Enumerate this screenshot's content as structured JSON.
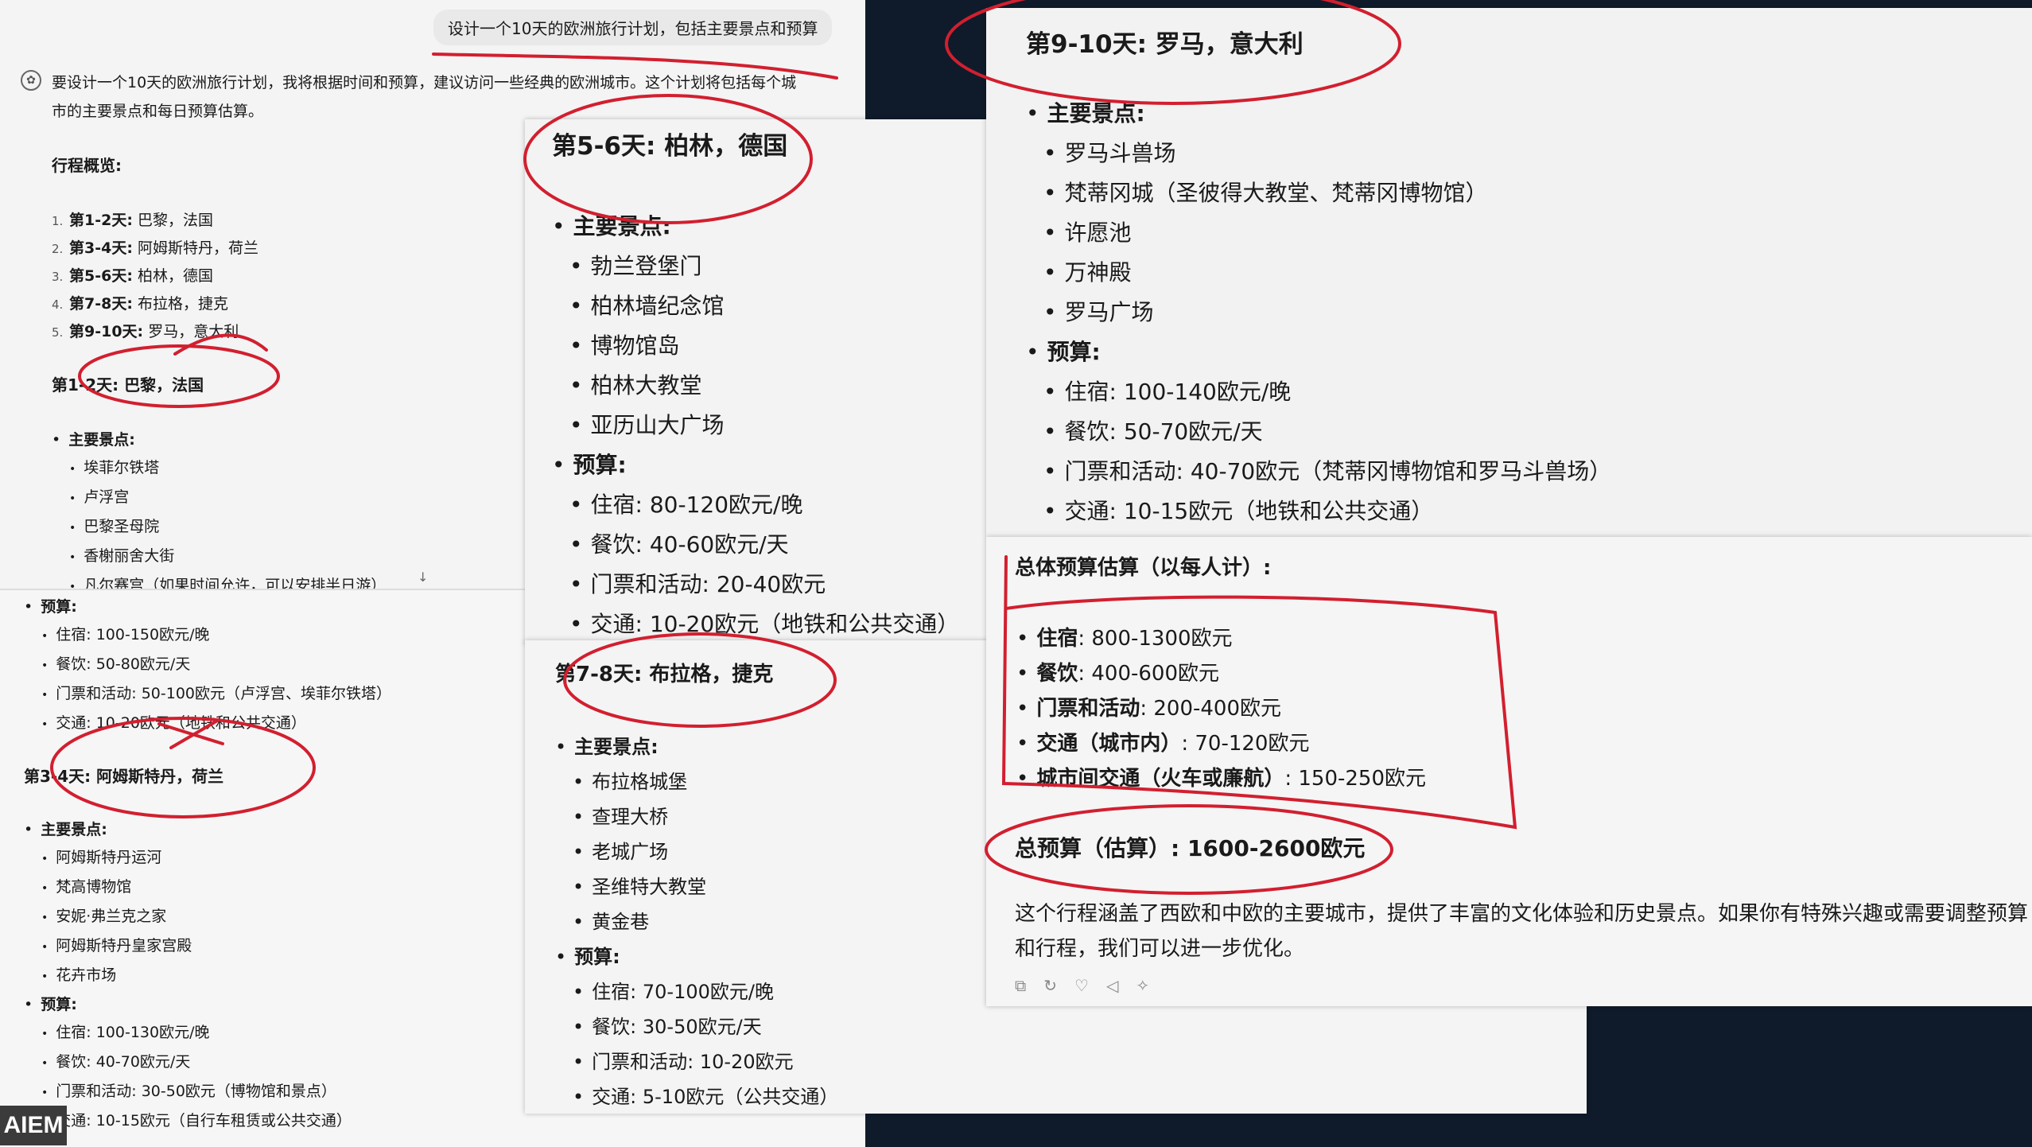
{
  "user_prompt": "设计一个10天的欧洲旅行计划，包括主要景点和预算",
  "intro": "要设计一个10天的欧洲旅行计划，我将根据时间和预算，建议访问一些经典的欧洲城市。这个计划将包括每个城市的主要景点和每日预算估算。",
  "overview": {
    "heading": "行程概览:",
    "items": [
      {
        "num": "1.",
        "days": "第1-2天:",
        "city": "巴黎，法国"
      },
      {
        "num": "2.",
        "days": "第3-4天:",
        "city": "阿姆斯特丹，荷兰"
      },
      {
        "num": "3.",
        "days": "第5-6天:",
        "city": "柏林，德国"
      },
      {
        "num": "4.",
        "days": "第7-8天:",
        "city": "布拉格，捷克"
      },
      {
        "num": "5.",
        "days": "第9-10天:",
        "city": "罗马，意大利"
      }
    ]
  },
  "paris": {
    "title": "第1-2天: 巴黎，法国",
    "attractions_label": "主要景点:",
    "attractions": [
      "埃菲尔铁塔",
      "卢浮宫",
      "巴黎圣母院",
      "香榭丽舍大街",
      "凡尔赛宫（如果时间允许，可以安排半日游）"
    ],
    "budget_label": "预算:",
    "budget": [
      "住宿: 100-150欧元/晚",
      "餐饮: 50-80欧元/天",
      "门票和活动: 50-100欧元（卢浮宫、埃菲尔铁塔）",
      "交通: 10-20欧元（地铁和公共交通）"
    ]
  },
  "amsterdam": {
    "title": "第3-4天: 阿姆斯特丹，荷兰",
    "attractions_label": "主要景点:",
    "attractions": [
      "阿姆斯特丹运河",
      "梵高博物馆",
      "安妮·弗兰克之家",
      "阿姆斯特丹皇家宫殿",
      "花卉市场"
    ],
    "budget_label": "预算:",
    "budget": [
      "住宿: 100-130欧元/晚",
      "餐饮: 40-70欧元/天",
      "门票和活动: 30-50欧元（博物馆和景点）",
      "交通: 10-15欧元（自行车租赁或公共交通）"
    ]
  },
  "berlin": {
    "title": "第5-6天: 柏林，德国",
    "attractions_label": "主要景点:",
    "attractions": [
      "勃兰登堡门",
      "柏林墙纪念馆",
      "博物馆岛",
      "柏林大教堂",
      "亚历山大广场"
    ],
    "budget_label": "预算:",
    "budget": [
      "住宿: 80-120欧元/晚",
      "餐饮: 40-60欧元/天",
      "门票和活动: 20-40欧元",
      "交通: 10-20欧元（地铁和公共交通）"
    ]
  },
  "prague": {
    "title": "第7-8天: 布拉格，捷克",
    "attractions_label": "主要景点:",
    "attractions": [
      "布拉格城堡",
      "查理大桥",
      "老城广场",
      "圣维特大教堂",
      "黄金巷"
    ],
    "budget_label": "预算:",
    "budget": [
      "住宿: 70-100欧元/晚",
      "餐饮: 30-50欧元/天",
      "门票和活动: 10-20欧元",
      "交通: 5-10欧元（公共交通）"
    ]
  },
  "rome": {
    "title": "第9-10天: 罗马，意大利",
    "attractions_label": "主要景点:",
    "attractions": [
      "罗马斗兽场",
      "梵蒂冈城（圣彼得大教堂、梵蒂冈博物馆）",
      "许愿池",
      "万神殿",
      "罗马广场"
    ],
    "budget_label": "预算:",
    "budget": [
      "住宿: 100-140欧元/晚",
      "餐饮: 50-70欧元/天",
      "门票和活动: 40-70欧元（梵蒂冈博物馆和罗马斗兽场）",
      "交通: 10-15欧元（地铁和公共交通）"
    ]
  },
  "total": {
    "heading": "总体预算估算（以每人计）:",
    "items": [
      {
        "label": "住宿",
        "value": ": 800-1300欧元"
      },
      {
        "label": "餐饮",
        "value": ": 400-600欧元"
      },
      {
        "label": "门票和活动",
        "value": ": 200-400欧元"
      },
      {
        "label": "交通（城市内）",
        "value": ": 70-120欧元"
      },
      {
        "label": "城市间交通（火车或廉航）",
        "value": ": 150-250欧元"
      }
    ],
    "grand_total": "总预算（估算）: 1600-2600欧元",
    "closing": "这个行程涵盖了西欧和中欧的主要城市，提供了丰富的文化体验和历史景点。如果你有特殊兴趣或需要调整预算和行程，我们可以进一步优化。"
  },
  "message_actions": [
    "copy-icon",
    "regenerate-icon",
    "dislike-icon",
    "speaker-icon",
    "sparkle-icon"
  ],
  "watermark": "AIEM",
  "scroll_icon": "↓"
}
